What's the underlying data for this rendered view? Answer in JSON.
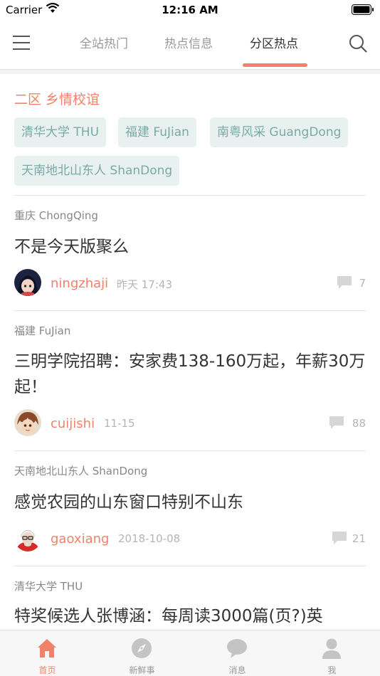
{
  "status_bar": {
    "carrier": "Carrier",
    "time": "12:16 AM"
  },
  "nav": {
    "tabs": [
      {
        "label": "全站热门"
      },
      {
        "label": "热点信息"
      },
      {
        "label": "分区热点"
      }
    ],
    "active_tab": 2
  },
  "zone": {
    "title": "二区 乡情校谊",
    "tags": [
      {
        "label": "清华大学 THU"
      },
      {
        "label": "福建 FuJian"
      },
      {
        "label": "南粤风采 GuangDong"
      },
      {
        "label": "天南地北山东人 ShanDong"
      }
    ]
  },
  "posts": [
    {
      "board": "重庆 ChongQing",
      "title": "不是今天版聚么",
      "author": "ningzhaji",
      "time": "昨天 17:43",
      "comments": "7"
    },
    {
      "board": "福建 FuJian",
      "title": "三明学院招聘：安家费138-160万起，年薪30万起！",
      "author": "cuijishi",
      "time": "11-15",
      "comments": "88"
    },
    {
      "board": "天南地北山东人 ShanDong",
      "title": "感觉农园的山东窗口特别不山东",
      "author": "gaoxiang",
      "time": "2018-10-08",
      "comments": "21"
    },
    {
      "board": "清华大学 THU",
      "title": "特奖候选人张博涵：每周读3000篇(页?)英"
    }
  ],
  "tab_bar": {
    "items": [
      {
        "label": "首页",
        "icon": "home-icon"
      },
      {
        "label": "新鲜事",
        "icon": "compass-icon"
      },
      {
        "label": "消息",
        "icon": "message-icon"
      },
      {
        "label": "我",
        "icon": "person-icon"
      }
    ],
    "active": 0
  },
  "colors": {
    "accent": "#f0826a",
    "tag_bg": "#e8f1f0",
    "tag_text": "#7aaaa6"
  }
}
